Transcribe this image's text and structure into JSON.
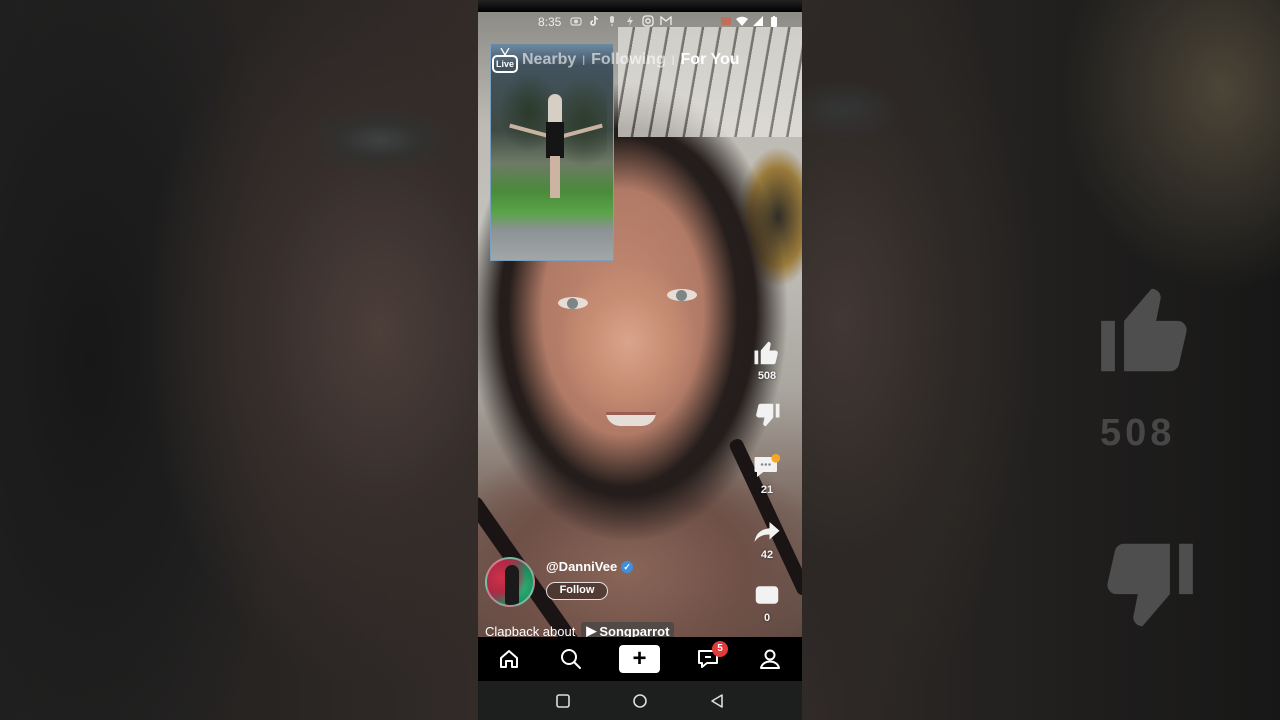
{
  "status_bar": {
    "time": "8:35",
    "notification_icons": [
      "camera-icon",
      "tiktok-icon",
      "mic-icon",
      "flash-icon",
      "instagram-icon",
      "gmail-icon"
    ],
    "system_icons": [
      "cast-icon",
      "wifi-icon",
      "signal-icon",
      "battery-icon"
    ]
  },
  "top_tabs": {
    "items": [
      {
        "label": "Nearby",
        "active": false
      },
      {
        "label": "Following",
        "active": false
      },
      {
        "label": "For You",
        "active": true
      }
    ],
    "live_label": "Live"
  },
  "rail": {
    "like_count": "508",
    "comment_count": "21",
    "share_count": "42",
    "save_count": "0"
  },
  "creator": {
    "handle": "@DanniVee",
    "verified": true,
    "follow_label": "Follow"
  },
  "caption": {
    "text": "Clapback about",
    "song_label": "Songparrot"
  },
  "bottom_nav": {
    "items": [
      "home",
      "search",
      "create",
      "inbox",
      "profile"
    ],
    "plus_label": "+",
    "inbox_badge": "5"
  },
  "background": {
    "ghost_like_count": "508"
  },
  "colors": {
    "badge": "#e33a3a",
    "verified": "#3d8fe0",
    "nav_bg": "#000000",
    "sys_nav_bg": "#1d1f1e"
  }
}
